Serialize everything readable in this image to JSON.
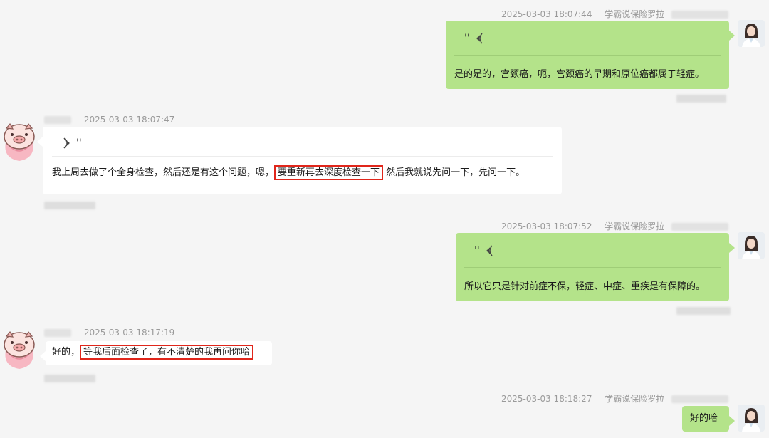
{
  "messages": [
    {
      "timestamp": "2025-03-03 18:07:44",
      "sender": "学霸说保险罗拉",
      "voice_mark": "''",
      "text": "是的是的，宫颈癌，呃，宫颈癌的早期和原位癌都属于轻症。"
    },
    {
      "timestamp": "2025-03-03 18:07:47",
      "voice_mark": "''",
      "text_before": "我上周去做了个全身检查，然后还是有这个问题，嗯，",
      "text_highlight": "要重新再去深度检查一下",
      "text_after": "然后我就说先问一下，先问一下。"
    },
    {
      "timestamp": "2025-03-03 18:07:52",
      "sender": "学霸说保险罗拉",
      "voice_mark": "''",
      "text": "所以它只是针对前症不保，轻症、中症、重疾是有保障的。"
    },
    {
      "timestamp": "2025-03-03 18:17:19",
      "text_before": "好的，",
      "text_highlight": "等我后面检查了，有不清楚的我再问你哈"
    },
    {
      "timestamp": "2025-03-03 18:18:27",
      "sender": "学霸说保险罗拉",
      "text": "好的哈"
    }
  ],
  "icons": {
    "voice_right": "voice-waves-icon",
    "voice_left": "voice-waves-icon",
    "avatar_left": "pig-avatar-icon",
    "avatar_right": "woman-avatar-icon"
  },
  "colors": {
    "green_bubble": "#b4e38a",
    "white_bubble": "#ffffff",
    "highlight_border": "#e0261b",
    "timestamp": "#9a9a9a"
  }
}
